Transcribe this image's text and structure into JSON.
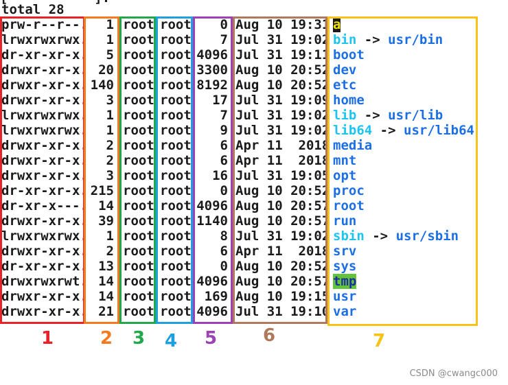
{
  "terminal": {
    "cutoff_line": "[-----------].",
    "total_line": "total 28",
    "rows": [
      {
        "perm": "prw-r--r--.",
        "links": "1",
        "owner": "root",
        "group": "root",
        "size": "0",
        "date": "Aug 10 19:31",
        "name": "a",
        "kind": "hl-black",
        "target": ""
      },
      {
        "perm": "lrwxrwxrwx.",
        "links": "1",
        "owner": "root",
        "group": "root",
        "size": "7",
        "date": "Jul 31 19:02",
        "name": "bin",
        "kind": "link",
        "target": "usr/bin"
      },
      {
        "perm": "dr-xr-xr-x.",
        "links": "5",
        "owner": "root",
        "group": "root",
        "size": "4096",
        "date": "Jul 31 19:11",
        "name": "boot",
        "kind": "dir",
        "target": ""
      },
      {
        "perm": "drwxr-xr-x.",
        "links": "20",
        "owner": "root",
        "group": "root",
        "size": "3300",
        "date": "Aug 10 20:52",
        "name": "dev",
        "kind": "dir",
        "target": ""
      },
      {
        "perm": "drwxr-xr-x.",
        "links": "140",
        "owner": "root",
        "group": "root",
        "size": "8192",
        "date": "Aug 10 20:52",
        "name": "etc",
        "kind": "dir",
        "target": ""
      },
      {
        "perm": "drwxr-xr-x.",
        "links": "3",
        "owner": "root",
        "group": "root",
        "size": "17",
        "date": "Jul 31 19:09",
        "name": "home",
        "kind": "dir",
        "target": ""
      },
      {
        "perm": "lrwxrwxrwx.",
        "links": "1",
        "owner": "root",
        "group": "root",
        "size": "7",
        "date": "Jul 31 19:02",
        "name": "lib",
        "kind": "link",
        "target": "usr/lib"
      },
      {
        "perm": "lrwxrwxrwx.",
        "links": "1",
        "owner": "root",
        "group": "root",
        "size": "9",
        "date": "Jul 31 19:02",
        "name": "lib64",
        "kind": "link",
        "target": "usr/lib64"
      },
      {
        "perm": "drwxr-xr-x.",
        "links": "2",
        "owner": "root",
        "group": "root",
        "size": "6",
        "date": "Apr 11  2018",
        "name": "media",
        "kind": "dir",
        "target": ""
      },
      {
        "perm": "drwxr-xr-x.",
        "links": "2",
        "owner": "root",
        "group": "root",
        "size": "6",
        "date": "Apr 11  2018",
        "name": "mnt",
        "kind": "dir",
        "target": ""
      },
      {
        "perm": "drwxr-xr-x.",
        "links": "3",
        "owner": "root",
        "group": "root",
        "size": "16",
        "date": "Jul 31 19:05",
        "name": "opt",
        "kind": "dir",
        "target": ""
      },
      {
        "perm": "dr-xr-xr-x.",
        "links": "215",
        "owner": "root",
        "group": "root",
        "size": "0",
        "date": "Aug 10 20:52",
        "name": "proc",
        "kind": "dir",
        "target": ""
      },
      {
        "perm": "dr-xr-x---.",
        "links": "14",
        "owner": "root",
        "group": "root",
        "size": "4096",
        "date": "Aug 10 20:57",
        "name": "root",
        "kind": "dir",
        "target": ""
      },
      {
        "perm": "drwxr-xr-x.",
        "links": "39",
        "owner": "root",
        "group": "root",
        "size": "1140",
        "date": "Aug 10 20:57",
        "name": "run",
        "kind": "dir",
        "target": ""
      },
      {
        "perm": "lrwxrwxrwx.",
        "links": "1",
        "owner": "root",
        "group": "root",
        "size": "8",
        "date": "Jul 31 19:02",
        "name": "sbin",
        "kind": "link",
        "target": "usr/sbin"
      },
      {
        "perm": "drwxr-xr-x.",
        "links": "2",
        "owner": "root",
        "group": "root",
        "size": "6",
        "date": "Apr 11  2018",
        "name": "srv",
        "kind": "dir",
        "target": ""
      },
      {
        "perm": "dr-xr-xr-x.",
        "links": "13",
        "owner": "root",
        "group": "root",
        "size": "0",
        "date": "Aug 10 20:52",
        "name": "sys",
        "kind": "dir",
        "target": ""
      },
      {
        "perm": "drwxrwxrwt.",
        "links": "14",
        "owner": "root",
        "group": "root",
        "size": "4096",
        "date": "Aug 10 20:57",
        "name": "tmp",
        "kind": "hl-green",
        "target": ""
      },
      {
        "perm": "drwxr-xr-x.",
        "links": "14",
        "owner": "root",
        "group": "root",
        "size": "169",
        "date": "Aug 10 19:15",
        "name": "usr",
        "kind": "dir",
        "target": ""
      },
      {
        "perm": "drwxr-xr-x.",
        "links": "21",
        "owner": "root",
        "group": "root",
        "size": "4096",
        "date": "Jul 31 19:10",
        "name": "var",
        "kind": "dir",
        "target": ""
      }
    ],
    "arrow": "->"
  },
  "annotations": [
    {
      "label": "1",
      "color": "#e8222a"
    },
    {
      "label": "2",
      "color": "#f47a20"
    },
    {
      "label": "3",
      "color": "#21a84a"
    },
    {
      "label": "4",
      "color": "#1f9fe0"
    },
    {
      "label": "5",
      "color": "#9b43b4"
    },
    {
      "label": "6",
      "color": "#b07a5a"
    },
    {
      "label": "7",
      "color": "#f5c319"
    }
  ],
  "colors": {
    "directory": "#1b6fe3",
    "symlink": "#1cc4ef",
    "text": "#1a1a1a"
  },
  "watermark": "CSDN @cwangc000"
}
